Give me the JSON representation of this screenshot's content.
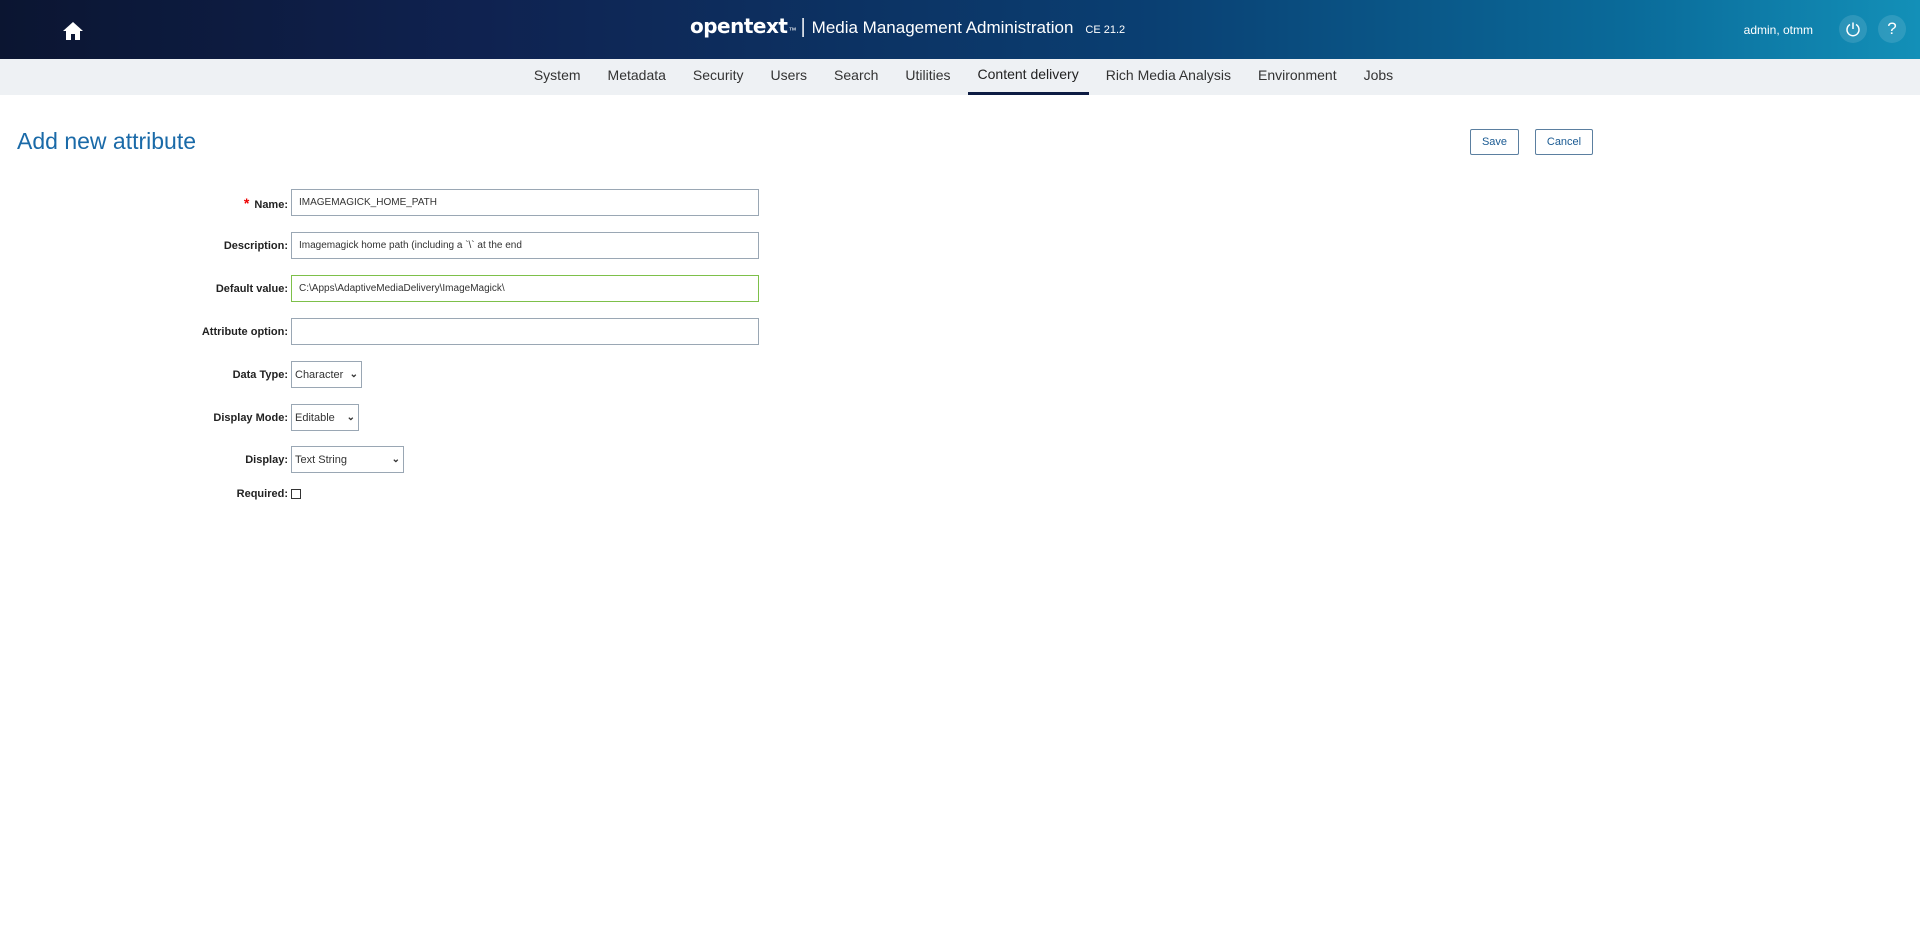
{
  "header": {
    "brand": "opentext",
    "brand_tm": "™",
    "separator": "|",
    "app_title": "Media Management Administration",
    "version": "CE 21.2",
    "user": "admin, otmm",
    "help_label": "?"
  },
  "nav": {
    "items": [
      {
        "label": "System",
        "active": false
      },
      {
        "label": "Metadata",
        "active": false
      },
      {
        "label": "Security",
        "active": false
      },
      {
        "label": "Users",
        "active": false
      },
      {
        "label": "Search",
        "active": false
      },
      {
        "label": "Utilities",
        "active": false
      },
      {
        "label": "Content delivery",
        "active": true
      },
      {
        "label": "Rich Media Analysis",
        "active": false
      },
      {
        "label": "Environment",
        "active": false
      },
      {
        "label": "Jobs",
        "active": false
      }
    ]
  },
  "page": {
    "title": "Add new attribute",
    "save_label": "Save",
    "cancel_label": "Cancel"
  },
  "form": {
    "name": {
      "label": "Name:",
      "value": "IMAGEMAGICK_HOME_PATH",
      "required_mark": "*"
    },
    "description": {
      "label": "Description:",
      "value": "Imagemagick home path (including a `\\` at the end"
    },
    "default_value": {
      "label": "Default value:",
      "value": "C:\\Apps\\AdaptiveMediaDelivery\\ImageMagick\\"
    },
    "attribute_option": {
      "label": "Attribute option:",
      "value": ""
    },
    "data_type": {
      "label": "Data Type:",
      "value": "Character"
    },
    "display_mode": {
      "label": "Display Mode:",
      "value": "Editable"
    },
    "display": {
      "label": "Display:",
      "value": "Text String"
    },
    "required": {
      "label": "Required:",
      "checked": false
    }
  },
  "colors": {
    "accent": "#1a6aa8",
    "nav_active": "#0d1c43",
    "focus": "#7dc04a"
  }
}
